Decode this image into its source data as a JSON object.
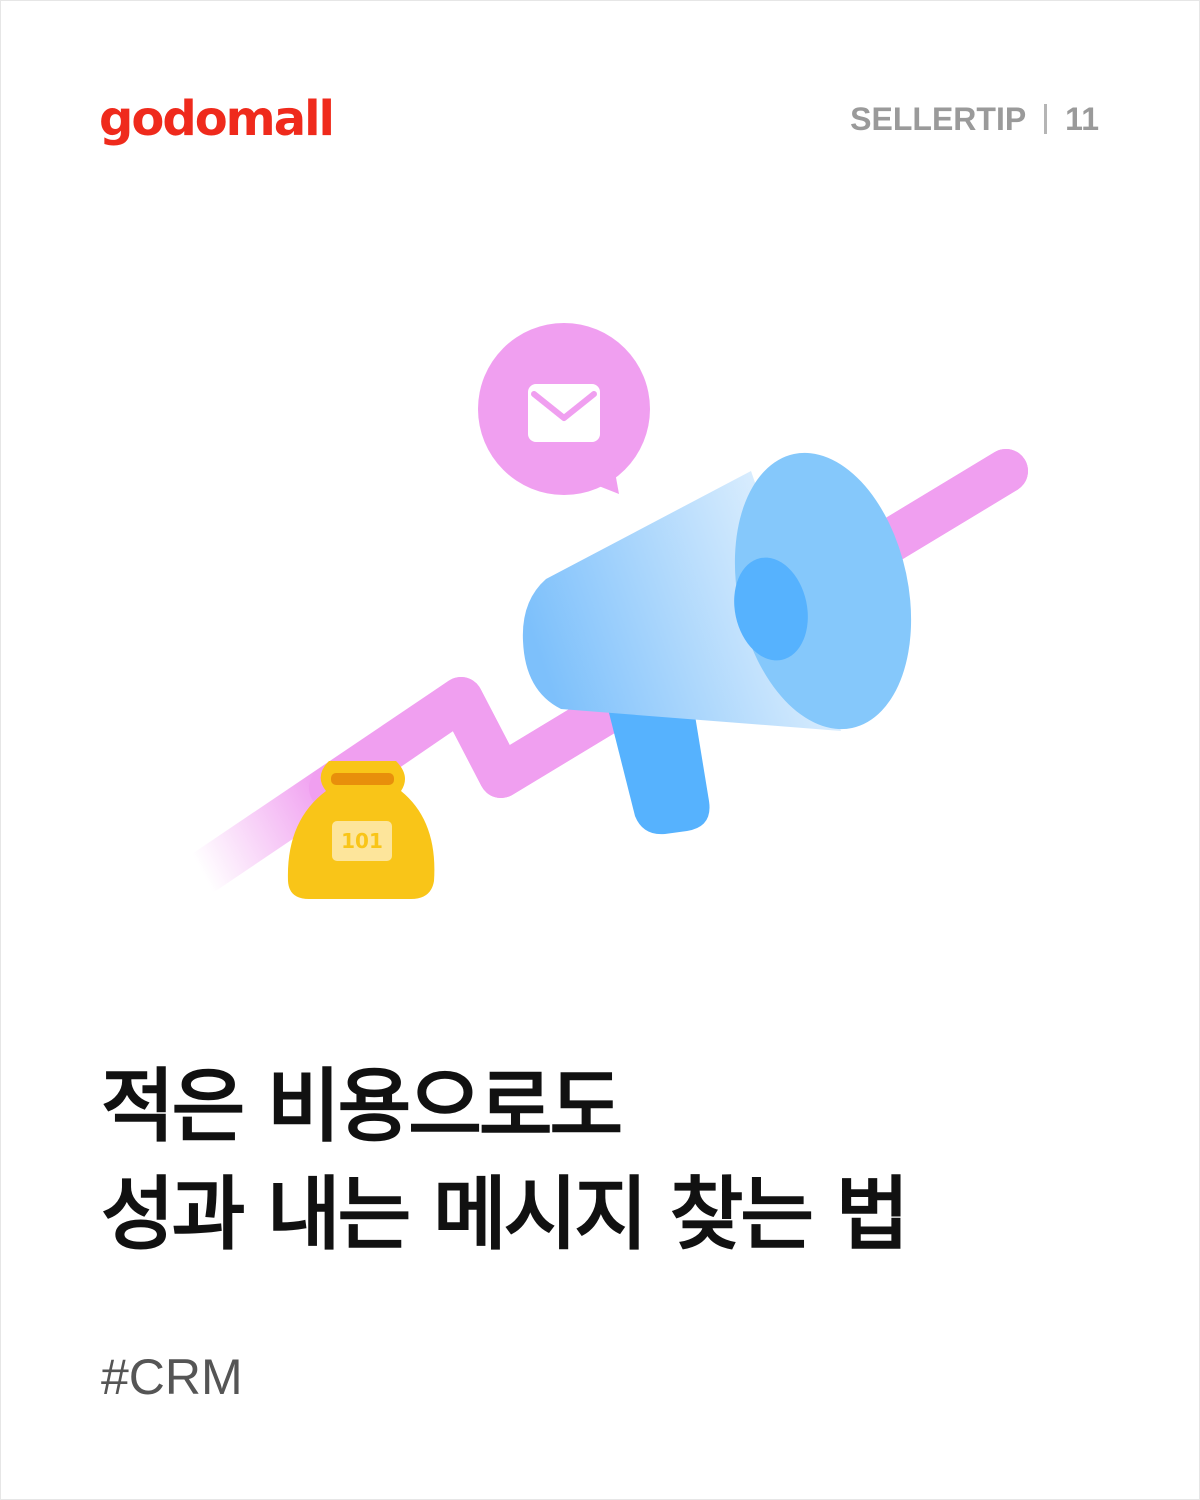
{
  "brand": {
    "logo_text": "godomall",
    "logo_color": "#ef2a1c"
  },
  "series": {
    "label": "SELLERTIP",
    "number": "11"
  },
  "illustration": {
    "bubble_icon": "envelope-icon",
    "main_icon": "megaphone-icon",
    "bag_icon": "money-bag-icon",
    "bag_label": "101",
    "trend_icon": "rising-trend-line",
    "colors": {
      "pink": "#f09ff0",
      "blue": "#85c8fb",
      "blue_dark": "#56b2fe",
      "gold": "#f9c518"
    }
  },
  "headline": {
    "line1": "적은 비용으로도",
    "line2": "성과 내는 메시지 찾는 법"
  },
  "tag": "#CRM"
}
